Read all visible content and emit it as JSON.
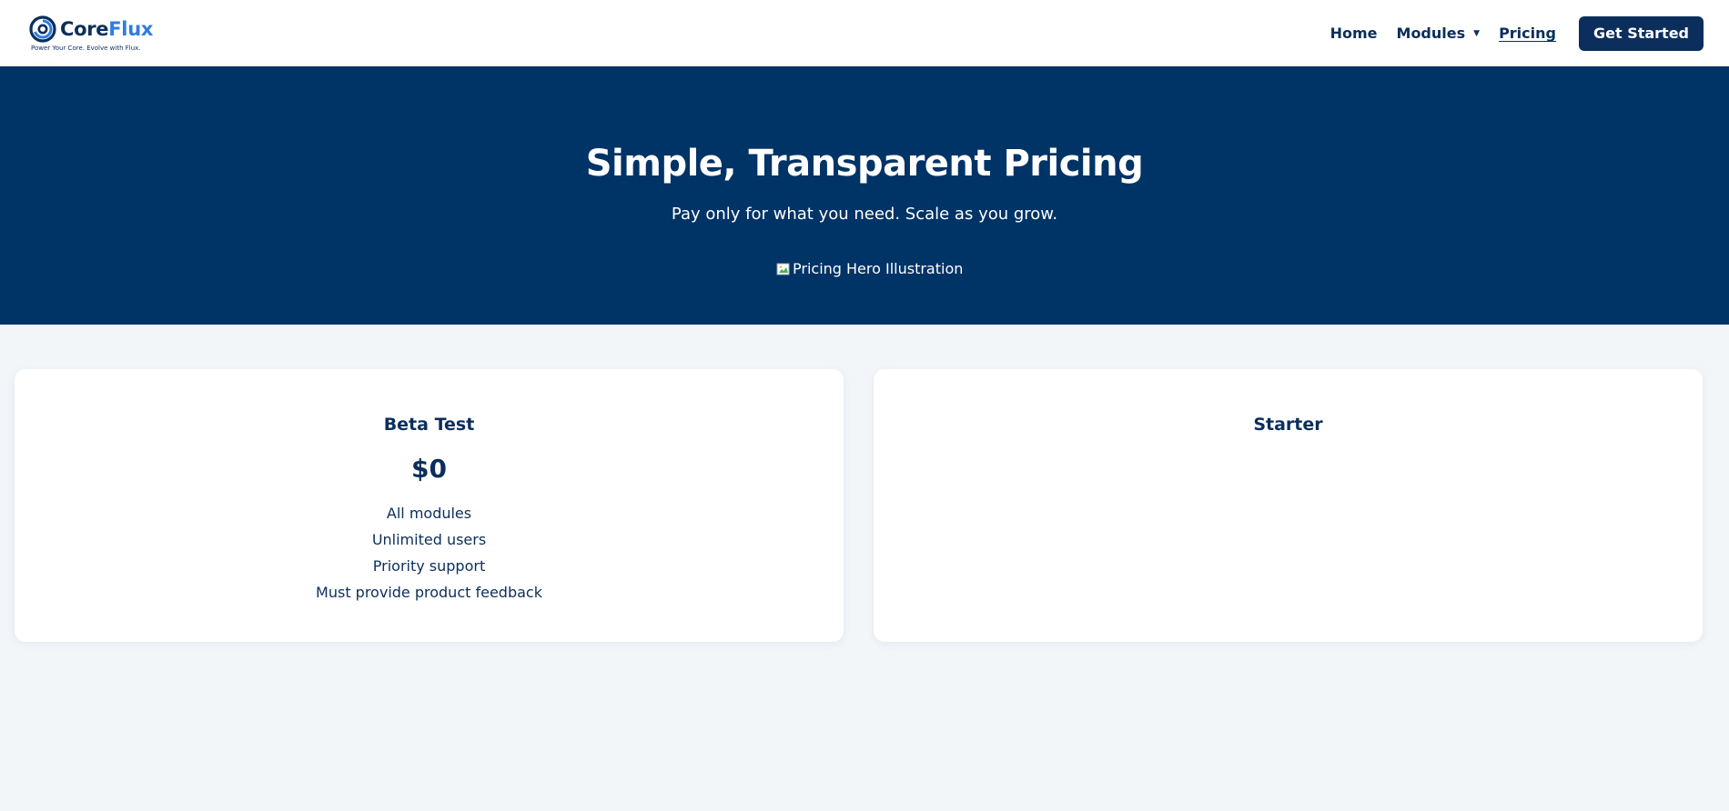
{
  "header": {
    "brand_core": "Core",
    "brand_flux": "Flux",
    "tagline": "Power Your Core. Evolve with Flux.",
    "nav": {
      "home": "Home",
      "modules": "Modules",
      "pricing": "Pricing"
    },
    "cta_label": "Get Started"
  },
  "hero": {
    "title": "Simple, Transparent Pricing",
    "subtitle": "Pay only for what you need. Scale as you grow.",
    "image_alt": "Pricing Hero Illustration"
  },
  "plans": [
    {
      "name": "Beta Test",
      "price": "$0",
      "features": [
        "All modules",
        "Unlimited users",
        "Priority support",
        "Must provide product feedback"
      ]
    },
    {
      "name": "Starter"
    }
  ],
  "colors": {
    "navy": "#0b2e5c",
    "hero_bg": "#003366",
    "accent_blue": "#2f7de1",
    "page_bg": "#f3f6f9"
  },
  "icons": {
    "logo": "spiral-logo-icon",
    "modules_caret": "caret-down-icon",
    "hero_image": "broken-image-icon"
  }
}
